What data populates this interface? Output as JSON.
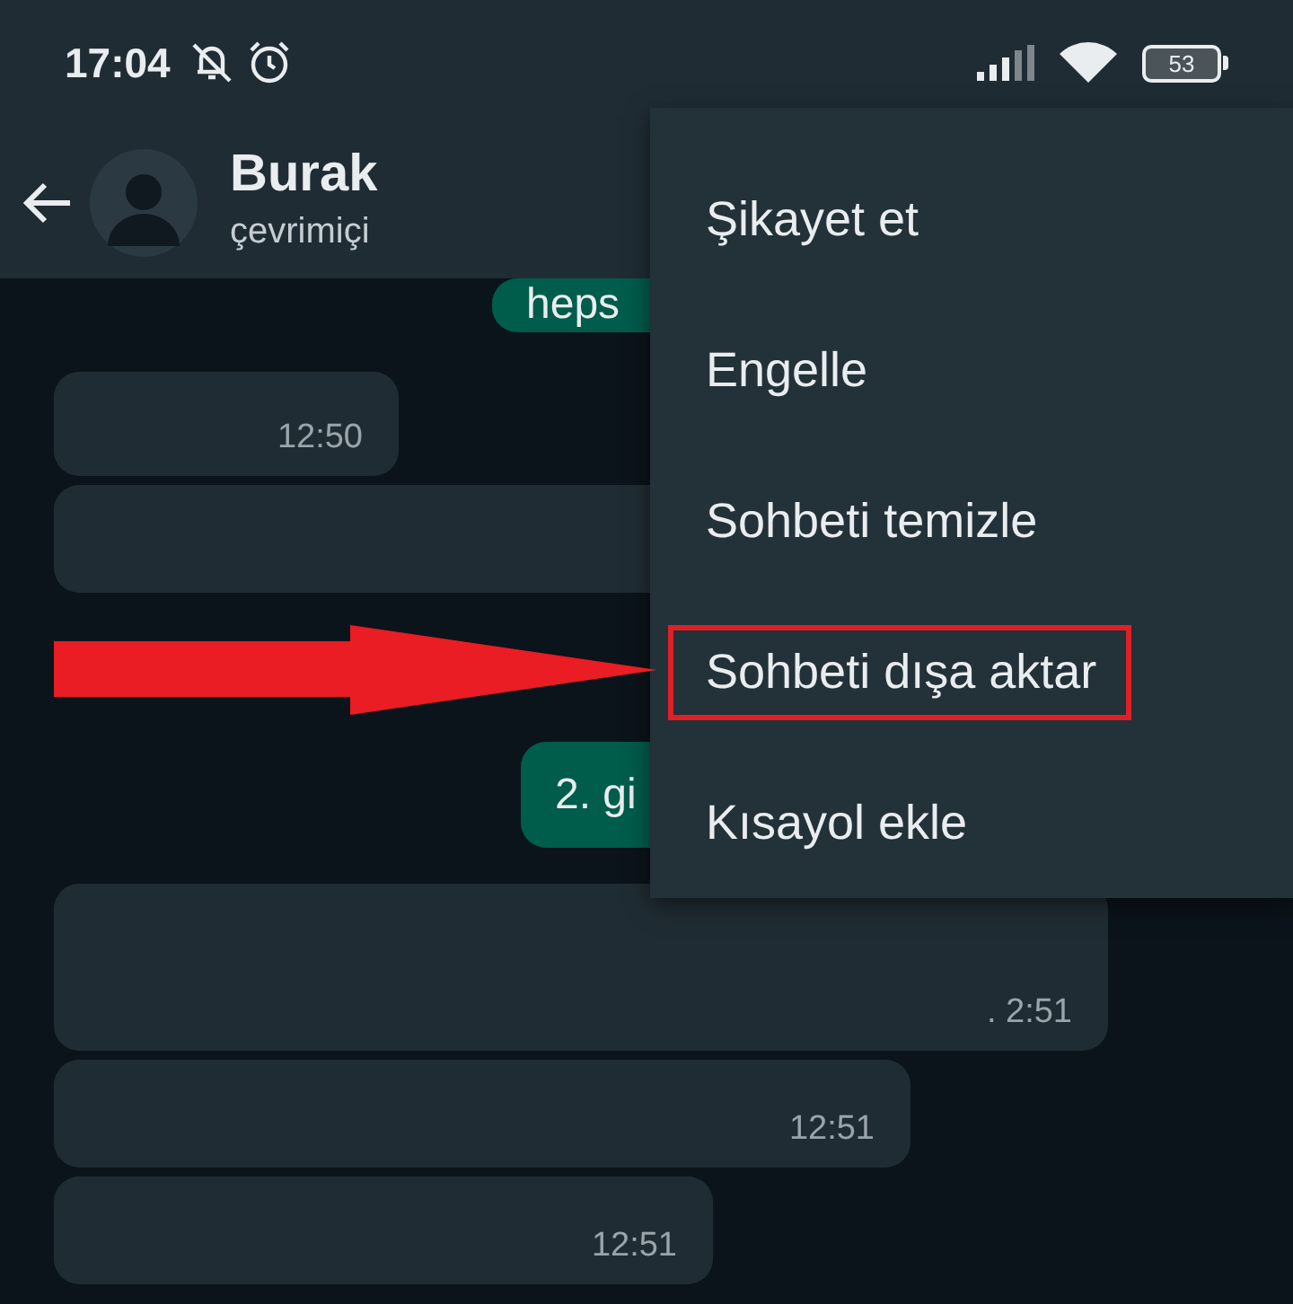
{
  "status_bar": {
    "time": "17:04",
    "battery": "53"
  },
  "header": {
    "name": "Burak",
    "status": "çevrimiçi"
  },
  "messages": [
    {
      "kind": "outgoing",
      "text": "heps"
    },
    {
      "kind": "incoming",
      "time": "12:50"
    },
    {
      "kind": "incoming"
    },
    {
      "kind": "outgoing",
      "text": "2. gi"
    },
    {
      "kind": "incoming",
      "time": ". 2:51"
    },
    {
      "kind": "incoming",
      "time": "12:51"
    },
    {
      "kind": "incoming",
      "time": "12:51"
    }
  ],
  "menu": {
    "items": [
      {
        "label": "Şikayet et",
        "highlighted": false
      },
      {
        "label": "Engelle",
        "highlighted": false
      },
      {
        "label": "Sohbeti temizle",
        "highlighted": false
      },
      {
        "label": "Sohbeti dışa aktar",
        "highlighted": true
      },
      {
        "label": "Kısayol ekle",
        "highlighted": false
      }
    ]
  }
}
